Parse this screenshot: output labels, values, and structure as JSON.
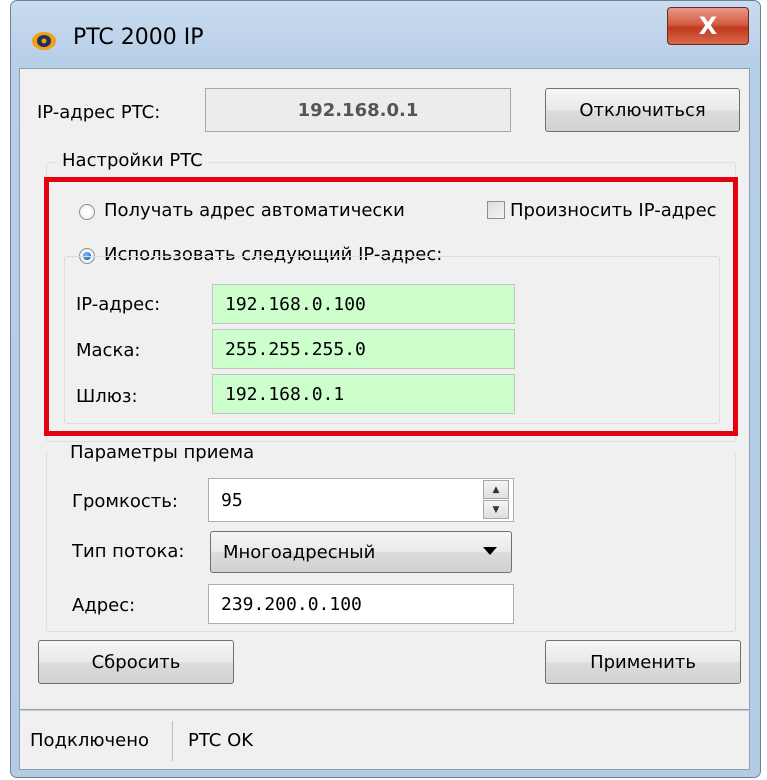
{
  "window": {
    "title": "PTC 2000 IP",
    "close_label": "X"
  },
  "connection": {
    "ip_label": "IP-адрес PTC:",
    "ip_value": "192.168.0.1",
    "disconnect_label": "Отключиться"
  },
  "settings": {
    "group_title": "Настройки PTC",
    "auto_label": "Получать адрес автоматически",
    "announce_label": "Произносить IP-адрес",
    "manual_label": "Использовать следующий IP-адрес:",
    "auto_selected": false,
    "manual_selected": true,
    "announce_checked": false,
    "ip_label": "IP-адрес:",
    "ip_value": "192.168.0.100",
    "mask_label": "Маска:",
    "mask_value": "255.255.255.0",
    "gateway_label": "Шлюз:",
    "gateway_value": "192.168.0.1"
  },
  "receive": {
    "group_title": "Параметры приема",
    "volume_label": "Громкость:",
    "volume_value": "95",
    "stream_label": "Тип потока:",
    "stream_value": "Многоадресный",
    "address_label": "Адрес:",
    "address_value": "239.200.0.100"
  },
  "actions": {
    "reset_label": "Сбросить",
    "apply_label": "Применить"
  },
  "status": {
    "connection": "Подключено",
    "device": "PTC OK"
  },
  "colors": {
    "highlight": "#e3000f",
    "field_green": "#ccffcc"
  },
  "icons": {
    "app": "ptc-app-icon",
    "close": "close-icon",
    "spin_up": "spin-up-icon",
    "spin_down": "spin-down-icon",
    "dropdown": "chevron-down-icon"
  }
}
